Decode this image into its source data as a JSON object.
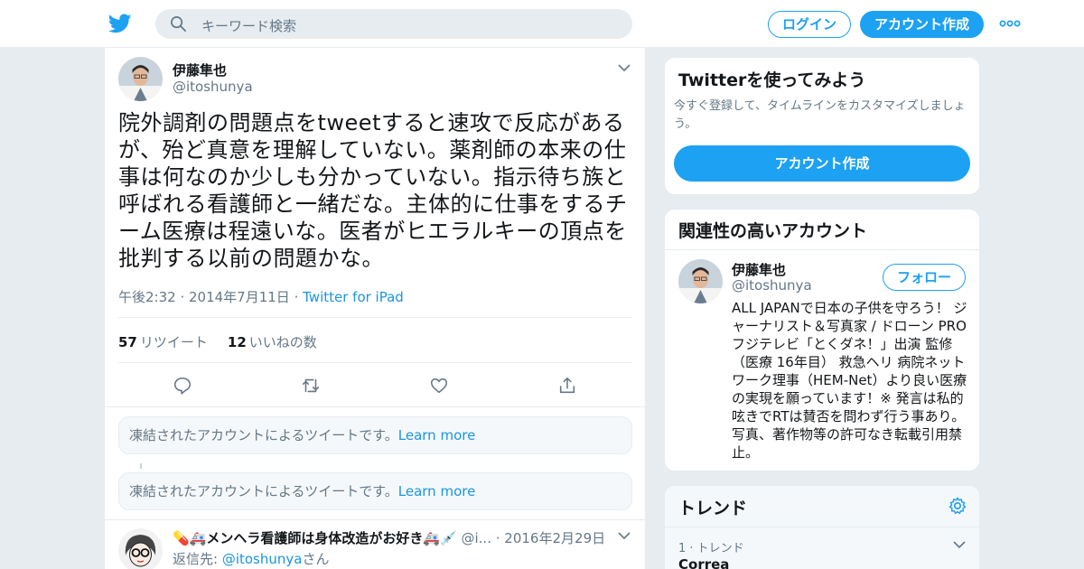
{
  "colors": {
    "accent": "#1da1f2",
    "link": "#1b95e0",
    "muted": "#657786",
    "text": "#14171a",
    "background": "#e6ecf0"
  },
  "nav": {
    "logo_icon": "twitter-bird-icon",
    "search_placeholder": "キーワード検索",
    "login_label": "ログイン",
    "signup_label": "アカウント作成",
    "more_icon": "more-dots-icon"
  },
  "tweet": {
    "author_name": "伊藤隼也",
    "author_handle": "@itoshunya",
    "text": "院外調剤の問題点をtweetすると速攻で反応があるが、殆ど真意を理解していない。薬剤師の本来の仕事は何なのか少しも分かっていない。指示待ち族と呼ばれる看護師と一緒だな。主体的に仕事をするチーム医療は程遠いな。医者がヒエラルキーの頂点を批判する以前の問題かな。",
    "timestamp": "午後2:32 · 2014年7月11日",
    "source": "Twitter for iPad",
    "retweet_count": "57",
    "retweet_label": "リツイート",
    "like_count": "12",
    "like_label": "いいねの数"
  },
  "notices": [
    {
      "text": "凍結されたアカウントによるツイートです。",
      "link": "Learn more"
    },
    {
      "text": "凍結されたアカウントによるツイートです。",
      "link": "Learn more"
    }
  ],
  "reply": {
    "author_name": "💊🚑メンヘラ看護師は身体改造がお好き🚑💉",
    "author_handle": "@i...",
    "date": "· 2016年2月29日",
    "reply_prefix": "返信先: ",
    "reply_handle": "@itoshunya",
    "reply_suffix": "さん"
  },
  "sidebar": {
    "signup_card": {
      "title": "Twitterを使ってみよう",
      "description": "今すぐ登録して、タイムラインをカスタマイズしましょう。",
      "button": "アカウント作成"
    },
    "related_card": {
      "title": "関連性の高いアカウント",
      "name": "伊藤隼也",
      "handle": "@itoshunya",
      "follow_label": "フォロー",
      "bio": "ALL JAPANで日本の子供を守ろう！ ジャーナリスト＆写真家 / ドローン PRO フジテレビ「とくダネ！」出演 監修（医療 16年目） 救急ヘリ 病院ネットワーク理事（HEM-Net）より良い医療の実現を願っています！※ 発言は私的呟きでRTは賛否を問わず行う事あり。写真、著作物等の許可なき転載引用禁止。"
    },
    "trends_card": {
      "title": "トレンド",
      "items": [
        {
          "meta": "1 · トレンド",
          "name": "Correa"
        }
      ]
    }
  }
}
